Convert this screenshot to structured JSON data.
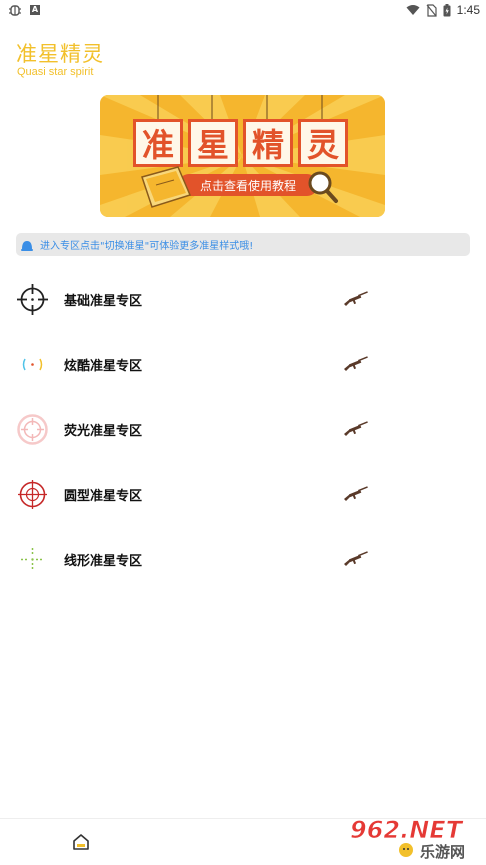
{
  "status_bar": {
    "time": "1:45",
    "notif_letter": "A"
  },
  "header": {
    "title": "准星精灵",
    "subtitle": "Quasi star spirit"
  },
  "banner": {
    "chars": [
      "准",
      "星",
      "精",
      "灵"
    ],
    "caption": "点击查看使用教程",
    "colors": {
      "bg": "#f5b62e",
      "ray": "#f9cf55",
      "tag": "#e2532a"
    }
  },
  "notice": {
    "text": "进入专区点击\"切换准星\"可体验更多准星样式哦!"
  },
  "zones": [
    {
      "label": "基础准星专区",
      "icon": "crosshair-basic-icon",
      "color": "#222222"
    },
    {
      "label": "炫酷准星专区",
      "icon": "crosshair-cool-icon",
      "color": "#4fc3e8"
    },
    {
      "label": "荧光准星专区",
      "icon": "crosshair-glow-icon",
      "color": "#f3b8b8"
    },
    {
      "label": "圆型准星专区",
      "icon": "crosshair-round-icon",
      "color": "#c62828"
    },
    {
      "label": "线形准星专区",
      "icon": "crosshair-line-icon",
      "color": "#8bc34a"
    }
  ],
  "bottom_nav": {
    "home_icon": "home-icon"
  },
  "watermark": {
    "brand": "962.NET",
    "site": "乐游网"
  }
}
